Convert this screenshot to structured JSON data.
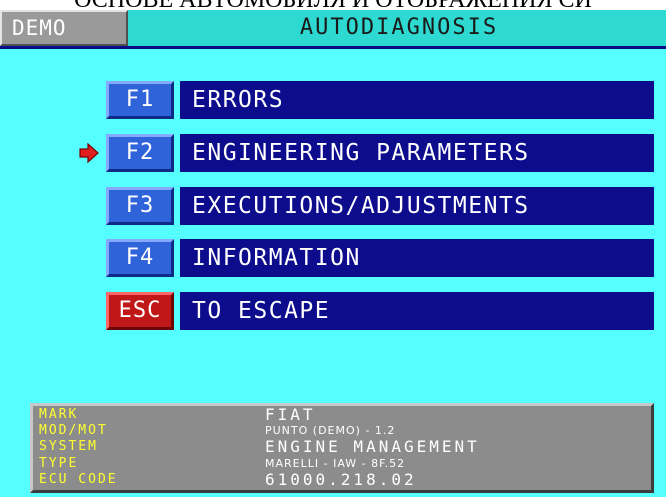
{
  "doc_header": "ОСНОВЕ АВТОМОБИЛЯ И ОТОБРАЖЕНИЯ СИ",
  "title_bar": {
    "mode_tab": "DEMO",
    "app_title": "AUTODIAGNOSIS"
  },
  "menu": {
    "selected_index": 1,
    "items": [
      {
        "key": "F1",
        "label": "ERRORS"
      },
      {
        "key": "F2",
        "label": "ENGINEERING PARAMETERS"
      },
      {
        "key": "F3",
        "label": "EXECUTIONS/ADJUSTMENTS"
      },
      {
        "key": "F4",
        "label": "INFORMATION"
      },
      {
        "key": "ESC",
        "label": "TO ESCAPE"
      }
    ]
  },
  "vehicle_info": {
    "rows": [
      {
        "label": "MARK",
        "value": "FIAT"
      },
      {
        "label": "MOD/MOT",
        "value": "PUNTO (DEMO) - 1.2"
      },
      {
        "label": "SYSTEM",
        "value": "ENGINE MANAGEMENT"
      },
      {
        "label": "TYPE",
        "value": "MARELLI - IAW - 8F.52"
      },
      {
        "label": "ECU CODE",
        "value": "61000.218.02"
      }
    ]
  },
  "icons": {
    "selection_arrow": "arrow-right-icon"
  },
  "colors": {
    "background": "#55ffff",
    "title_bar": "#2dd9d0",
    "menu_bar": "#0c0c8c",
    "function_key": "#2f63d9",
    "escape_key": "#c01818",
    "selection_arrow": "#e02020",
    "info_label": "#ffff30",
    "info_panel": "#8c8c8c"
  }
}
